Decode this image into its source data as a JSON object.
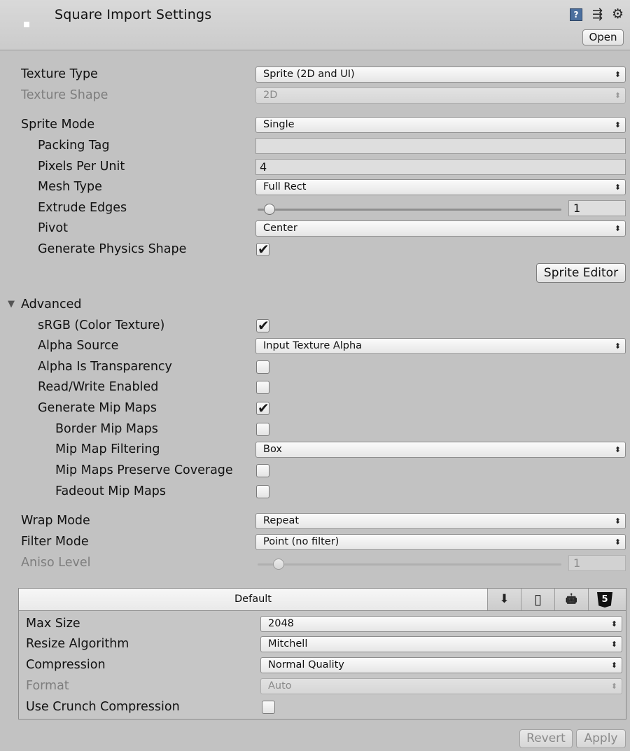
{
  "header": {
    "title": "Square Import Settings",
    "help_glyph": "?",
    "presets_glyph": "⇶",
    "gear_glyph": "⚙",
    "open_label": "Open"
  },
  "texture_type": {
    "label": "Texture Type",
    "value": "Sprite (2D and UI)"
  },
  "texture_shape": {
    "label": "Texture Shape",
    "value": "2D"
  },
  "sprite_mode": {
    "label": "Sprite Mode",
    "value": "Single"
  },
  "packing_tag": {
    "label": "Packing Tag",
    "value": ""
  },
  "pixels_per_unit": {
    "label": "Pixels Per Unit",
    "value": "4"
  },
  "mesh_type": {
    "label": "Mesh Type",
    "value": "Full Rect"
  },
  "extrude_edges": {
    "label": "Extrude Edges",
    "value": "1",
    "slider_fraction": 0.03
  },
  "pivot": {
    "label": "Pivot",
    "value": "Center"
  },
  "generate_physics_shape": {
    "label": "Generate Physics Shape",
    "checked": true
  },
  "sprite_editor_label": "Sprite Editor",
  "advanced": {
    "label": "Advanced",
    "foldout_glyph": "▼",
    "srgb": {
      "label": "sRGB (Color Texture)",
      "checked": true
    },
    "alpha_source": {
      "label": "Alpha Source",
      "value": "Input Texture Alpha"
    },
    "alpha_is_transparency": {
      "label": "Alpha Is Transparency",
      "checked": false
    },
    "read_write": {
      "label": "Read/Write Enabled",
      "checked": false
    },
    "generate_mip_maps": {
      "label": "Generate Mip Maps",
      "checked": true
    },
    "border_mip_maps": {
      "label": "Border Mip Maps",
      "checked": false
    },
    "mip_map_filtering": {
      "label": "Mip Map Filtering",
      "value": "Box"
    },
    "mip_maps_preserve_coverage": {
      "label": "Mip Maps Preserve Coverage",
      "checked": false
    },
    "fadeout_mip_maps": {
      "label": "Fadeout Mip Maps",
      "checked": false
    }
  },
  "wrap_mode": {
    "label": "Wrap Mode",
    "value": "Repeat"
  },
  "filter_mode": {
    "label": "Filter Mode",
    "value": "Point (no filter)"
  },
  "aniso_level": {
    "label": "Aniso Level",
    "value": "1",
    "slider_fraction": 0.06
  },
  "platform": {
    "default_tab": "Default",
    "tab_icons": [
      "download-icon",
      "phone-icon",
      "android-icon",
      "html5-icon"
    ],
    "download_glyph": "⬇",
    "phone_glyph": "▯",
    "android_glyph": "🤖",
    "html5_glyph": "5",
    "max_size": {
      "label": "Max Size",
      "value": "2048"
    },
    "resize_algorithm": {
      "label": "Resize Algorithm",
      "value": "Mitchell"
    },
    "compression": {
      "label": "Compression",
      "value": "Normal Quality"
    },
    "format": {
      "label": "Format",
      "value": "Auto"
    },
    "use_crunch": {
      "label": "Use Crunch Compression",
      "checked": false
    }
  },
  "footer": {
    "revert_label": "Revert",
    "apply_label": "Apply"
  },
  "dropdown_arrow_glyph": "⬍",
  "check_glyph": "✔"
}
